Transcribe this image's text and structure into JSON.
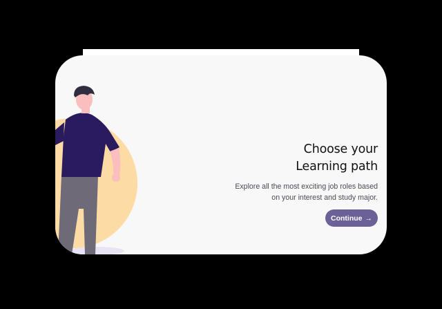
{
  "onboarding": {
    "title_line1": "Choose your",
    "title_line2": "Learning path",
    "description_line1": "Explore all the most exciting job roles based",
    "description_line2": "on your interest and study major.",
    "continue_label": "Continue",
    "continue_arrow": "→"
  },
  "colors": {
    "backdrop": "#000000",
    "card": "#f8f8f9",
    "accent_circle": "#fddba4",
    "shirt": "#2a1a5e",
    "pants": "#6e6a78",
    "skin": "#fbbebe",
    "hair": "#2f2e41",
    "button": "#6b6196"
  }
}
